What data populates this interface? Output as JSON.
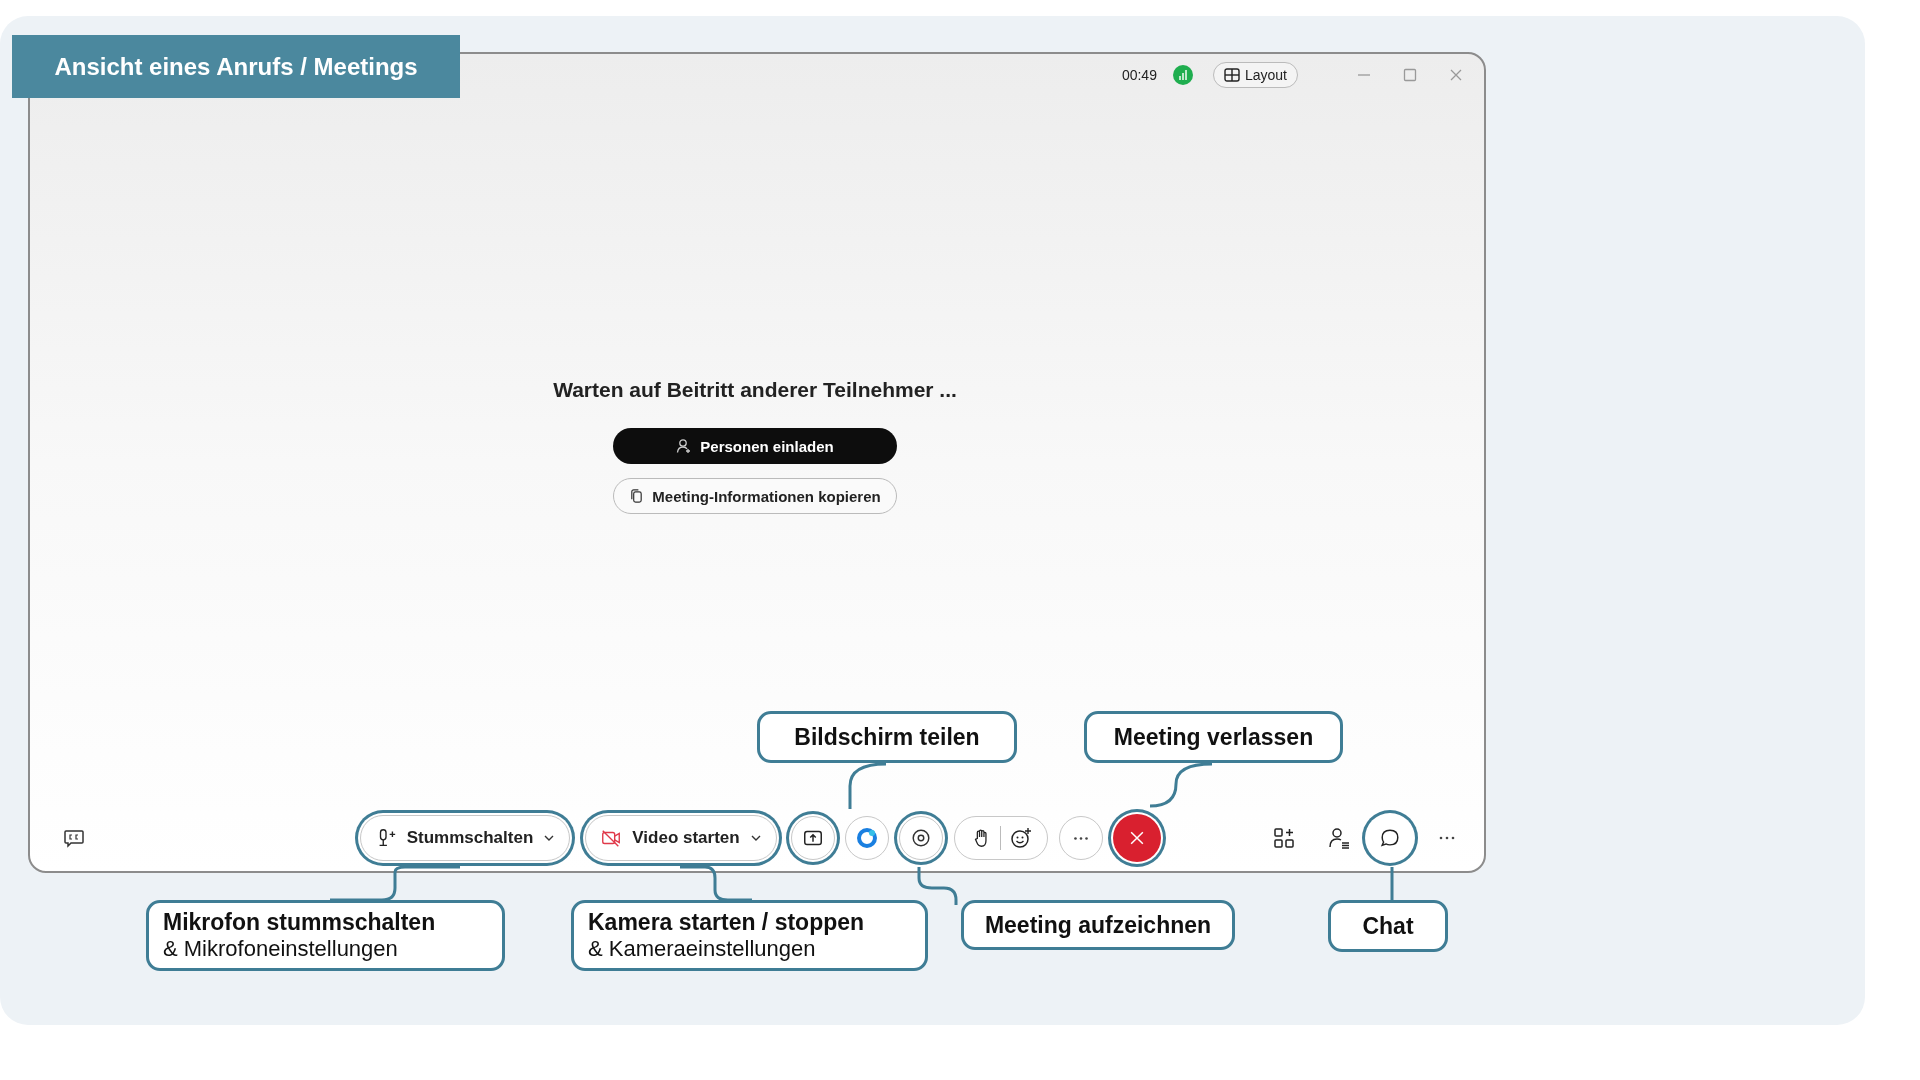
{
  "banner": {
    "title": "Ansicht eines Anrufs / Meetings"
  },
  "window": {
    "timer": "00:49",
    "layout_button": "Layout"
  },
  "main": {
    "message": "Warten auf Beitritt anderer Teilnehmer ...",
    "invite_button": "Personen einladen",
    "copy_button": "Meeting-Informationen kopieren"
  },
  "toolbar": [
    {
      "kind": "captions",
      "highlighted": false
    },
    {
      "kind": "mute",
      "label": "Stummschalten",
      "highlighted": true
    },
    {
      "kind": "video",
      "label": "Video starten",
      "highlighted": true
    },
    {
      "kind": "share",
      "highlighted": true
    },
    {
      "kind": "assistant",
      "highlighted": false
    },
    {
      "kind": "record",
      "highlighted": true
    },
    {
      "kind": "reactions",
      "highlighted": false
    },
    {
      "kind": "more",
      "highlighted": false
    },
    {
      "kind": "end",
      "highlighted": true
    },
    {
      "kind": "apps",
      "highlighted": false
    },
    {
      "kind": "participants",
      "highlighted": false
    },
    {
      "kind": "chat",
      "highlighted": true
    },
    {
      "kind": "moreplain",
      "highlighted": false
    }
  ],
  "callouts": [
    {
      "title": "Bildschirm teilen"
    },
    {
      "title": "Meeting verlassen"
    },
    {
      "title": "Mikrofon stummschalten",
      "subtitle": "& Mikrofoneinstellungen"
    },
    {
      "title": "Kamera starten / stoppen",
      "subtitle": "& Kameraeinstellungen"
    },
    {
      "title": "Meeting aufzeichnen"
    },
    {
      "title": "Chat"
    }
  ]
}
